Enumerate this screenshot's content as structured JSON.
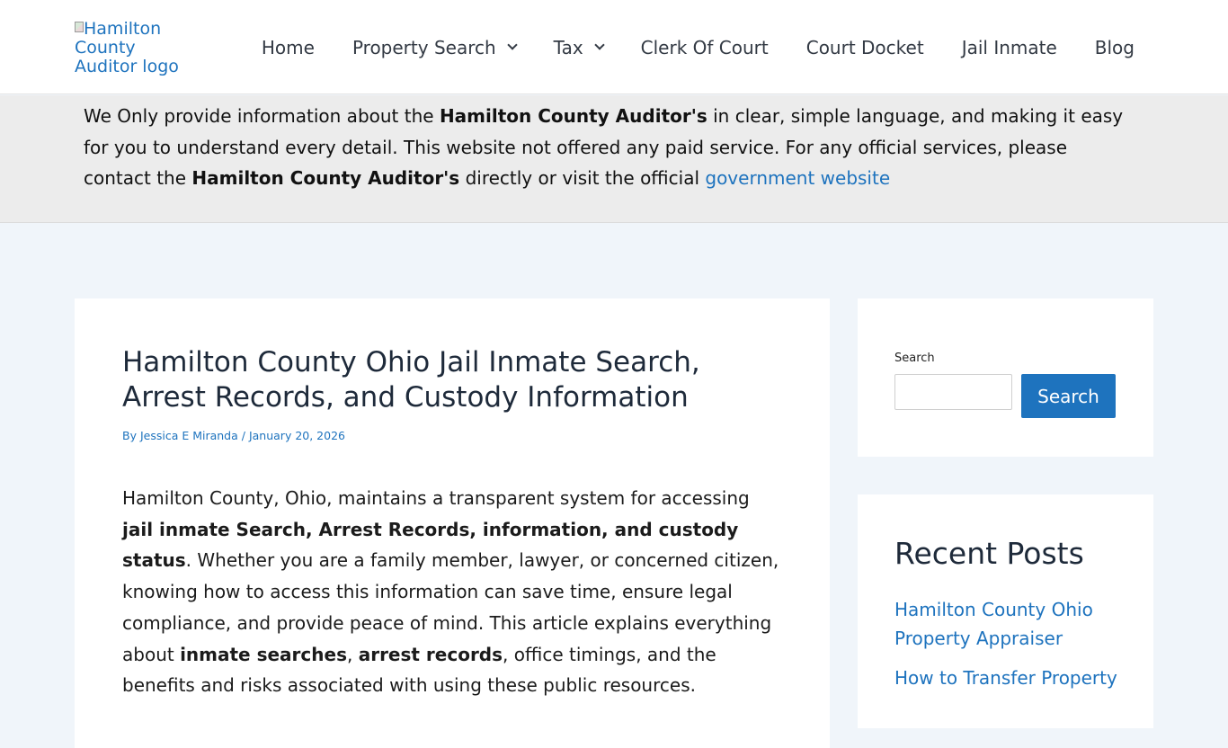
{
  "header": {
    "logo_alt": "Hamilton County Auditor logo",
    "nav": [
      {
        "label": "Home",
        "dropdown": false
      },
      {
        "label": "Property Search",
        "dropdown": true
      },
      {
        "label": "Tax",
        "dropdown": true
      },
      {
        "label": "Clerk Of Court",
        "dropdown": false
      },
      {
        "label": "Court Docket",
        "dropdown": false
      },
      {
        "label": "Jail Inmate",
        "dropdown": false
      },
      {
        "label": "Blog",
        "dropdown": false
      }
    ]
  },
  "notice": {
    "t1": "We Only provide information about the ",
    "b1": "Hamilton County Auditor's",
    "t2": " in clear, simple language, and making it easy for you to understand every detail. This website not offered any paid service. For any official services, please contact the  ",
    "b2": "Hamilton County Auditor's",
    "t3": " directly or visit the official ",
    "link": "government website"
  },
  "article": {
    "title": "Hamilton County Ohio Jail Inmate Search, Arrest Records, and Custody Information",
    "by": "By ",
    "author": "Jessica E Miranda",
    "sep": " / ",
    "date": "January 20, 2026",
    "p1": "Hamilton County, Ohio, maintains a transparent system for accessing ",
    "b1": "jail inmate Search, Arrest Records, information, and custody status",
    "p2": ". Whether you are a family member, lawyer, or concerned citizen, knowing how to access this information can save time, ensure legal compliance, and provide peace of mind. This article explains everything about ",
    "b2": "inmate searches",
    "p3": ", ",
    "b3": "arrest records",
    "p4": ", office timings, and the benefits and risks associated with using these public resources."
  },
  "sidebar": {
    "search_label": "Search",
    "search_value": "",
    "search_button": "Search",
    "recent_title": "Recent Posts",
    "recent": [
      "Hamilton County Ohio Property Appraiser",
      "How to Transfer Property"
    ]
  },
  "colors": {
    "accent": "#1e73be",
    "banner_bg": "#ececec",
    "page_bg": "#f0f5fa"
  }
}
